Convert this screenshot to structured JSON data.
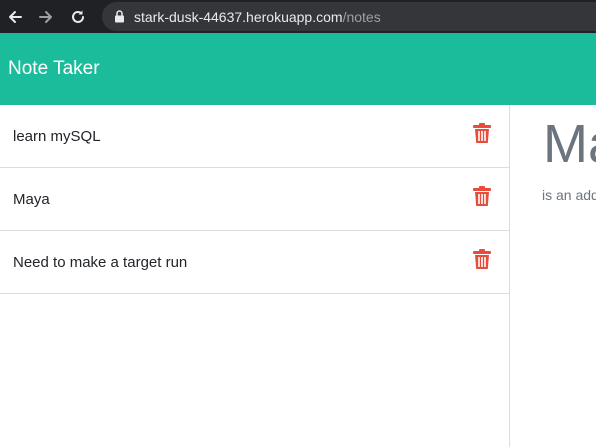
{
  "browser": {
    "url_host": "stark-dusk-44637.herokuapp.com",
    "url_path": "/notes"
  },
  "navbar": {
    "brand": "Note Taker",
    "color": "#1abc9c"
  },
  "notes": [
    {
      "title": "learn mySQL"
    },
    {
      "title": "Maya"
    },
    {
      "title": "Need to make a target run"
    }
  ],
  "detail": {
    "title": "Ma",
    "text": "is an add"
  },
  "icons": {
    "delete": "trash-icon",
    "delete_color": "#e74c3c"
  }
}
